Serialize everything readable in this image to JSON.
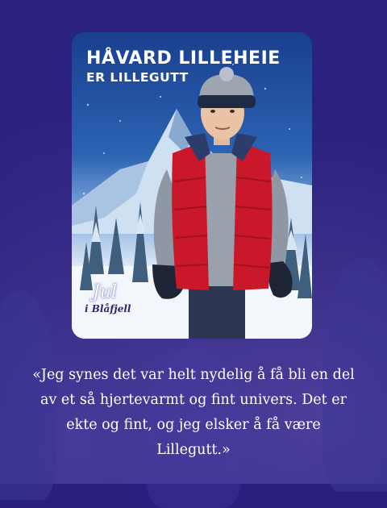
{
  "poster": {
    "title_line1": "HÅVARD LILLEHEIE",
    "title_line2": "ER LILLEGUTT",
    "logo_script": "Jul",
    "logo_text": "i Blåfjell"
  },
  "quote": {
    "text": "«Jeg synes det var helt nydelig å få bli en del av et så hjertevarmt og fint univers. Det er ekte og fint, og jeg elsker å få være Lillegutt.»"
  },
  "colors": {
    "background": "#2a1f7e",
    "vest": "#c8182a",
    "sky": "#2c63b3",
    "text": "#ffffff"
  }
}
